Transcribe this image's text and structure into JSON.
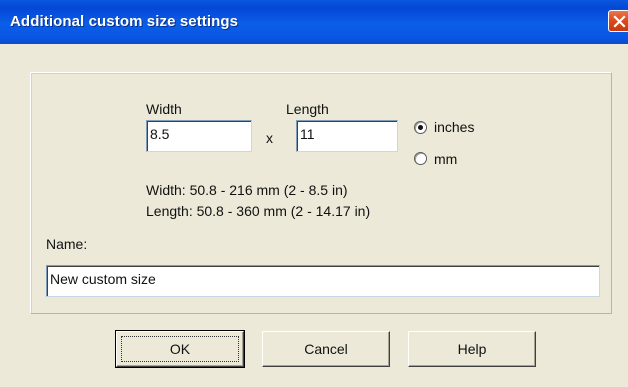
{
  "window": {
    "title": "Additional custom size settings"
  },
  "size": {
    "width_label": "Width",
    "width_value": "8.5",
    "times_symbol": "x",
    "length_label": "Length",
    "length_value": "11"
  },
  "units": {
    "options": [
      "inches",
      "mm"
    ],
    "selected": "inches"
  },
  "limits": {
    "width_text": "Width: 50.8 - 216 mm  (2 - 8.5 in)",
    "length_text": "Length: 50.8 - 360 mm  (2 - 14.17 in)"
  },
  "name": {
    "label": "Name:",
    "value": "New custom size"
  },
  "buttons": {
    "ok": "OK",
    "cancel": "Cancel",
    "help": "Help"
  }
}
